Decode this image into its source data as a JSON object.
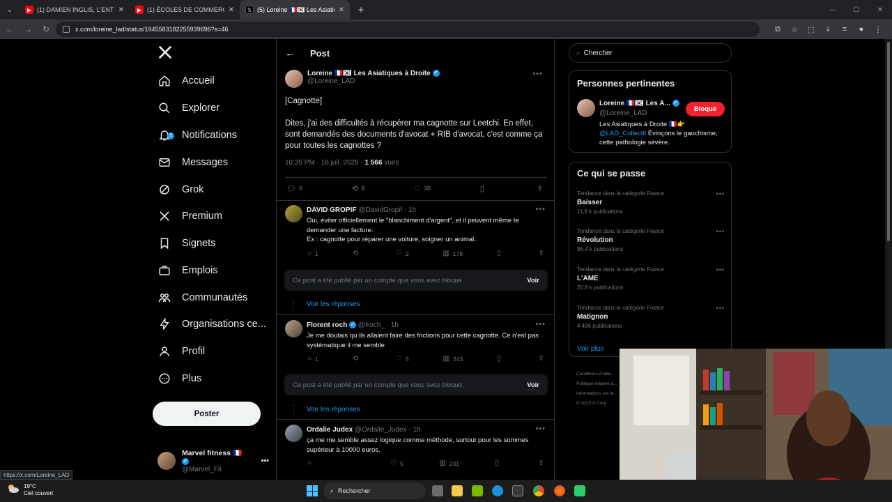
{
  "browser": {
    "tabs": [
      {
        "title": "(1) DAMIEN INGLIS, L'ENTRETIE",
        "color": "#ff0000"
      },
      {
        "title": "(1) ÉCOLES DE COMMERCE : AU",
        "color": "#ff0000"
      },
      {
        "title": "(5) Loreine 🇫🇷🇰🇷 Les Asiatiques",
        "color": "#000000"
      }
    ],
    "url": "x.com/loreine_lad/status/1945583182255939696?s=46",
    "status_url": "https://x.com/Loreine_LAD"
  },
  "sidebar": {
    "items": [
      {
        "label": "Accueil",
        "icon": "home-icon"
      },
      {
        "label": "Explorer",
        "icon": "search-icon"
      },
      {
        "label": "Notifications",
        "icon": "bell-icon",
        "badge": "5"
      },
      {
        "label": "Messages",
        "icon": "envelope-icon"
      },
      {
        "label": "Grok",
        "icon": "grok-icon"
      },
      {
        "label": "Premium",
        "icon": "x-logo-icon"
      },
      {
        "label": "Signets",
        "icon": "bookmark-icon"
      },
      {
        "label": "Emplois",
        "icon": "briefcase-icon"
      },
      {
        "label": "Communautés",
        "icon": "people-icon"
      },
      {
        "label": "Organisations ce...",
        "icon": "lightning-icon"
      },
      {
        "label": "Profil",
        "icon": "person-icon"
      },
      {
        "label": "Plus",
        "icon": "more-circle-icon"
      }
    ],
    "post_button": "Poster",
    "account": {
      "name": "Marvel fitness 🇫🇷",
      "handle": "@Marvel_Fit"
    }
  },
  "main": {
    "title": "Post",
    "op": {
      "name": "Loreine 🇫🇷🇰🇷 Les Asiatiques à Droite",
      "handle": "@Loreine_LAD",
      "text1": "[Cagnotte]",
      "text2": "Dites, j'ai des difficultés à récupérer ma cagnotte sur Leetchi. En effet, sont demandés des documents d'avocat + RIB d'avocat, c'est comme ça pour toutes les cagnottes ?",
      "time": "10:35 PM · 16 juil. 2025 · ",
      "views": "1 566",
      "views_label": " vues",
      "replies": "6",
      "reposts": "8",
      "likes": "38"
    },
    "replies": [
      {
        "name": "DAVID GROPIF",
        "handle": "@DavidGropif · 1h",
        "text": "Oui, éviter officiellement le \"blanchiment d'argent\", et il peuvent même te demander une facture.",
        "text2": "Ex : cagnotte pour réparer une voiture, soigner un animal..",
        "replies": "1",
        "reposts": "",
        "likes": "2",
        "views": "178"
      },
      {
        "name": "Florent roch",
        "handle": "@froch_ · 1h",
        "text": "Je me doutais qu ils allaient faire des frictions pour cette cagnotte. Ce n'est pas systématique il me semble",
        "replies": "1",
        "reposts": "",
        "likes": "5",
        "views": "243"
      },
      {
        "name": "Ordalie Judex",
        "handle": "@Ordalie_Judex · 1h",
        "text": "ça me me semble assez logique comme méthode, surtout pour les sommes supérieur à 10000 euros.",
        "replies": "",
        "reposts": "",
        "likes": "5",
        "views": "231"
      }
    ],
    "blocked_text": "Ce post a été publié par un compte que vous avez bloqué.",
    "blocked_voir": "Voir",
    "see_replies": "Voir les réponses"
  },
  "right": {
    "search_placeholder": "Chercher",
    "relevant_title": "Personnes pertinentes",
    "relevant": {
      "name": "Loreine 🇫🇷🇰🇷 Les A...",
      "handle": "@Loreine_LAD",
      "button": "Bloqué",
      "bio1": "Les Asiatiques à Droite 🇫🇷👉 ",
      "bio_mention": "@LAD_Collectif",
      "bio2": " Évinçons le gauchisme, cette pathologie sévère."
    },
    "trends_title": "Ce qui se passe",
    "trends": [
      {
        "cat": "Tendance dans la catégorie France",
        "name": "Baisser",
        "count": "11,8 k publications"
      },
      {
        "cat": "Tendance dans la catégorie France",
        "name": "Révolution",
        "count": "96,4 k publications"
      },
      {
        "cat": "Tendance dans la catégorie France",
        "name": "L'AME",
        "count": "20,8 k publications"
      },
      {
        "cat": "Tendance dans la catégorie France",
        "name": "Matignon",
        "count": "4 496 publications"
      }
    ],
    "see_more": "Voir plus",
    "footer": [
      "Conditions d'utilis...",
      "Politique relative a...",
      "Informations sur le...",
      "© 2025 X Corp."
    ]
  },
  "taskbar": {
    "temp": "19°C",
    "weather": "Ciel couvert",
    "search": "Rechercher"
  }
}
